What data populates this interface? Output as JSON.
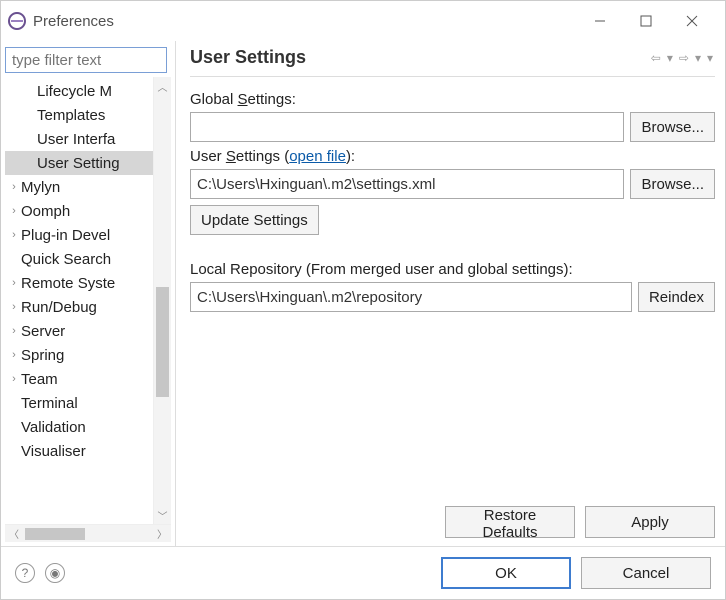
{
  "window": {
    "title": "Preferences"
  },
  "sidebar": {
    "filter_placeholder": "type filter text",
    "items": [
      {
        "label": "Lifecycle M",
        "child": true,
        "expandable": false
      },
      {
        "label": "Templates",
        "child": true,
        "expandable": false
      },
      {
        "label": "User Interfa",
        "child": true,
        "expandable": false
      },
      {
        "label": "User Setting",
        "child": true,
        "expandable": false,
        "selected": true
      },
      {
        "label": "Mylyn",
        "child": false,
        "expandable": true
      },
      {
        "label": "Oomph",
        "child": false,
        "expandable": true
      },
      {
        "label": "Plug-in Devel",
        "child": false,
        "expandable": true
      },
      {
        "label": "Quick Search",
        "child": false,
        "expandable": false
      },
      {
        "label": "Remote Syste",
        "child": false,
        "expandable": true
      },
      {
        "label": "Run/Debug",
        "child": false,
        "expandable": true
      },
      {
        "label": "Server",
        "child": false,
        "expandable": true
      },
      {
        "label": "Spring",
        "child": false,
        "expandable": true
      },
      {
        "label": "Team",
        "child": false,
        "expandable": true
      },
      {
        "label": "Terminal",
        "child": false,
        "expandable": false
      },
      {
        "label": "Validation",
        "child": false,
        "expandable": false
      },
      {
        "label": "Visualiser",
        "child": false,
        "expandable": false
      }
    ]
  },
  "content": {
    "heading": "User Settings",
    "global_label_pre": "Global ",
    "global_label_u": "S",
    "global_label_post": "ettings:",
    "global_value": "",
    "browse_label": "Browse...",
    "user_label_pre": "User ",
    "user_label_u": "S",
    "user_label_post": "ettings (",
    "open_file": "open file",
    "user_label_close": "):",
    "user_value": "C:\\Users\\Hxinguan\\.m2\\settings.xml",
    "update_label": "Update Settings",
    "local_repo_label": "Local Repository (From merged user and global settings):",
    "local_repo_value": "C:\\Users\\Hxinguan\\.m2\\repository",
    "reindex_label": "Reindex",
    "restore_defaults": "Restore Defaults",
    "apply": "Apply"
  },
  "footer": {
    "ok": "OK",
    "cancel": "Cancel"
  }
}
